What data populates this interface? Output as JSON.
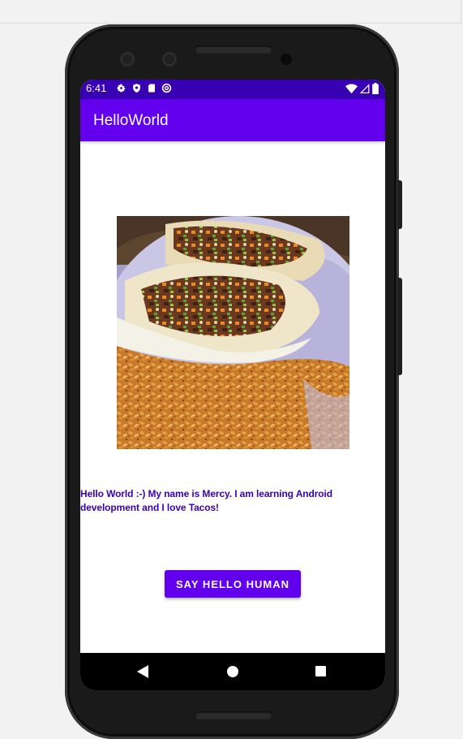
{
  "status_bar": {
    "time": "6:41",
    "icons_left": [
      "gear-icon",
      "shield-icon",
      "sd-card-icon",
      "at-sign-icon"
    ],
    "icons_right": [
      "wifi-icon",
      "signal-icon",
      "battery-icon"
    ]
  },
  "app_bar": {
    "title": "HelloWorld"
  },
  "main": {
    "image_subject": "tacos-with-rice",
    "text": "Hello World :-) My name is Mercy. I am learning Android development and I love Tacos!",
    "button_label": "SAY HELLO HUMAN"
  },
  "nav_bar": {
    "buttons": [
      "back-icon",
      "home-icon",
      "recents-icon"
    ]
  },
  "colors": {
    "primary": "#6200ee",
    "primary_dark": "#3700b3",
    "text_color": "#3700b3"
  }
}
